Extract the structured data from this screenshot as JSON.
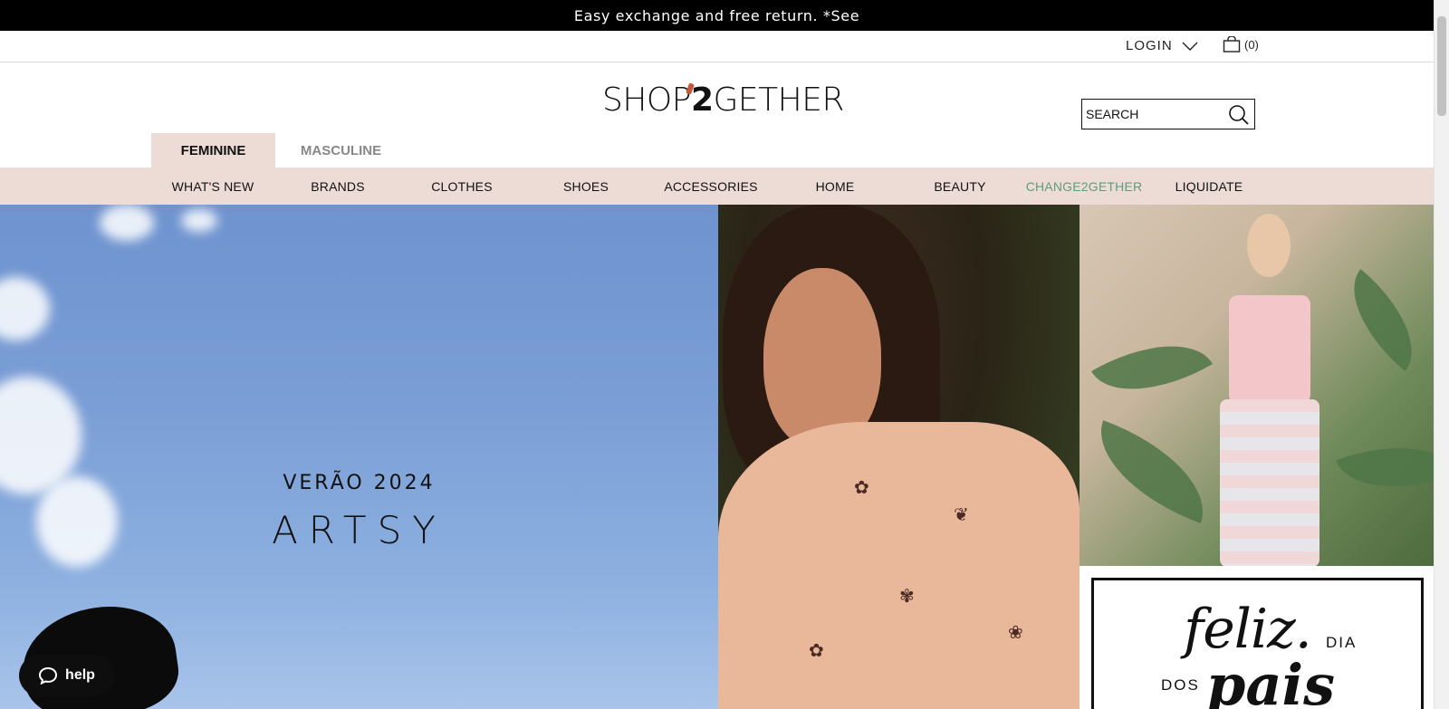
{
  "announcement": "Easy exchange and free return. *See",
  "utility": {
    "login_label": "LOGIN",
    "cart_count": "(0)"
  },
  "logo": {
    "text_before": "SHOP",
    "text_accent": "2",
    "text_after": "GETHER"
  },
  "search": {
    "placeholder": "SEARCH"
  },
  "gender_tabs": [
    {
      "label": "FEMININE",
      "active": true
    },
    {
      "label": "MASCULINE",
      "active": false
    }
  ],
  "nav": [
    {
      "label": "WHAT'S NEW"
    },
    {
      "label": "BRANDS"
    },
    {
      "label": "CLOTHES"
    },
    {
      "label": "SHOES"
    },
    {
      "label": "ACCESSORIES"
    },
    {
      "label": "HOME"
    },
    {
      "label": "BEAUTY"
    },
    {
      "label": "CHANGE2GETHER",
      "color": "#5e9c7e"
    },
    {
      "label": "LIQUIDATE"
    }
  ],
  "hero": {
    "subtitle": "VERÃO 2024",
    "title": "ARTSY"
  },
  "promo": {
    "feliz": "feliz.",
    "dia": "DIA",
    "dos": "DOS",
    "pais": "pais"
  },
  "help_label": "help",
  "colors": {
    "nav_bg": "#ecdcd5",
    "accent_green": "#5e9c7e",
    "announce_bg": "#000000"
  }
}
